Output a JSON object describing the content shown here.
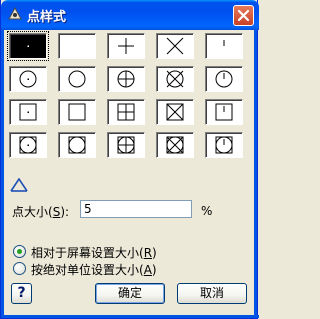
{
  "window": {
    "title": "点样式",
    "close_icon": "close-icon",
    "app_icon": "point-style-app-icon"
  },
  "styles": {
    "rows": [
      [
        "dot",
        "none",
        "plus",
        "x",
        "tick"
      ],
      [
        "circle-dot",
        "circle",
        "circle-plus",
        "circle-x",
        "circle-tick"
      ],
      [
        "square-dot",
        "square",
        "square-plus",
        "square-x",
        "square-tick"
      ],
      [
        "circle-square-dot",
        "circle-square",
        "circle-square-plus",
        "circle-square-x",
        "circle-square-tick"
      ]
    ],
    "selected": "dot"
  },
  "size": {
    "label": "点大小",
    "hotkey": "S",
    "value": "5",
    "unit": "%"
  },
  "mode": {
    "options": [
      {
        "label": "相对于屏幕设置大小",
        "hotkey": "R",
        "selected": true
      },
      {
        "label": "按绝对单位设置大小",
        "hotkey": "A",
        "selected": false
      }
    ]
  },
  "buttons": {
    "help": "?",
    "ok": "确定",
    "cancel": "取消"
  }
}
